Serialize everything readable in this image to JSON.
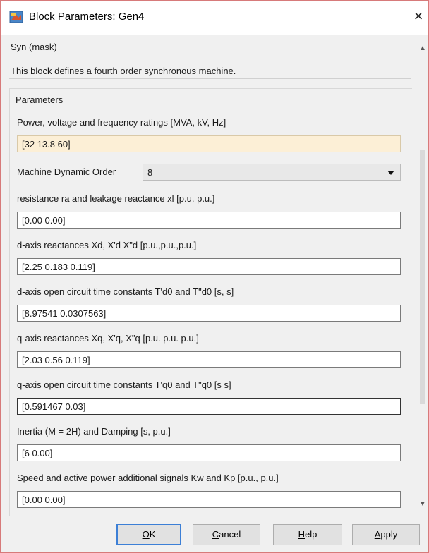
{
  "window": {
    "title": "Block Parameters: Gen4",
    "close_glyph": "×"
  },
  "mask": {
    "type_label": "Syn (mask)",
    "description": "This block defines  a fourth order synchronous machine."
  },
  "parameters": {
    "group_title": "Parameters",
    "ratings": {
      "label": "Power, voltage and frequency ratings [MVA, kV, Hz]",
      "value": "[32  13.8  60]"
    },
    "dynamic_order": {
      "label": "Machine Dynamic Order",
      "value": "8"
    },
    "resistance": {
      "label": "resistance ra and leakage reactance xl [p.u. p.u.]",
      "value": "[0.00  0.00]"
    },
    "d_reactances": {
      "label": "d-axis reactances Xd, X'd X\"d [p.u.,p.u.,p.u.]",
      "value": "[2.25  0.183  0.119]"
    },
    "d_time_constants": {
      "label": "d-axis open circuit time constants T'd0 and T\"d0 [s, s]",
      "value": "[8.97541  0.0307563]"
    },
    "q_reactances": {
      "label": "q-axis reactances Xq, X'q, X\"q [p.u.  p.u.  p.u.]",
      "value": "[2.03  0.56  0.119]"
    },
    "q_time_constants": {
      "label": "q-axis open circuit time constants T'q0 and T\"q0 [s s]",
      "value": "[0.591467  0.03]"
    },
    "inertia": {
      "label": "Inertia (M = 2H) and Damping [s, p.u.]",
      "value": "[6  0.00]"
    },
    "speed_power": {
      "label": "Speed and active power additional signals Kw and Kp [p.u., p.u.]",
      "value": "[0.00  0.00]"
    }
  },
  "buttons": {
    "ok_mnemonic": "O",
    "ok_rest": "K",
    "cancel_mnemonic": "C",
    "cancel_rest": "ancel",
    "help_mnemonic": "H",
    "help_rest": "elp",
    "apply_mnemonic": "A",
    "apply_rest": "pply"
  },
  "colors": {
    "active_field_bg": "#fcefd6",
    "primary_button_border": "#3c7fd6",
    "window_border": "#d77a7a"
  }
}
